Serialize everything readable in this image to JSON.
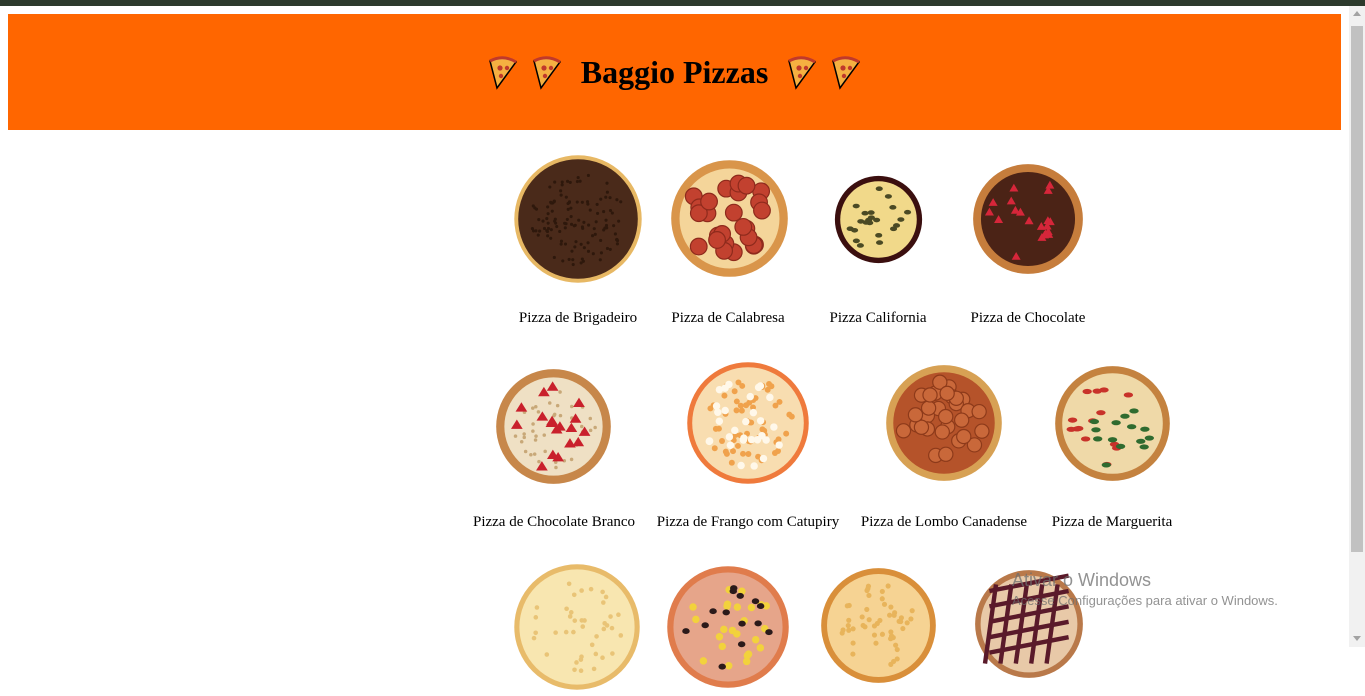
{
  "header": {
    "title": "Baggio Pizzas",
    "icon": "pizza-slice-icon",
    "background": "#ff6600"
  },
  "pizzas": [
    {
      "name": "Pizza de Brigadeiro",
      "style": "brigadeiro"
    },
    {
      "name": "Pizza de Calabresa",
      "style": "calabresa"
    },
    {
      "name": "Pizza California",
      "style": "california"
    },
    {
      "name": "Pizza de Chocolate",
      "style": "chocolate"
    },
    {
      "name": "Pizza de Chocolate Branco",
      "style": "chocolate-branco"
    },
    {
      "name": "Pizza de Frango com Catupiry",
      "style": "frango"
    },
    {
      "name": "Pizza de Lombo Canadense",
      "style": "lombo"
    },
    {
      "name": "Pizza de Marguerita",
      "style": "marguerita"
    },
    {
      "name": "",
      "style": "mussarela"
    },
    {
      "name": "",
      "style": "portuguesa"
    },
    {
      "name": "",
      "style": "quatro-queijos"
    },
    {
      "name": "",
      "style": "romeu-julieta"
    }
  ],
  "watermark": {
    "title": "Ativar o Windows",
    "subtitle": "Acesse Configurações para ativar o Windows."
  }
}
